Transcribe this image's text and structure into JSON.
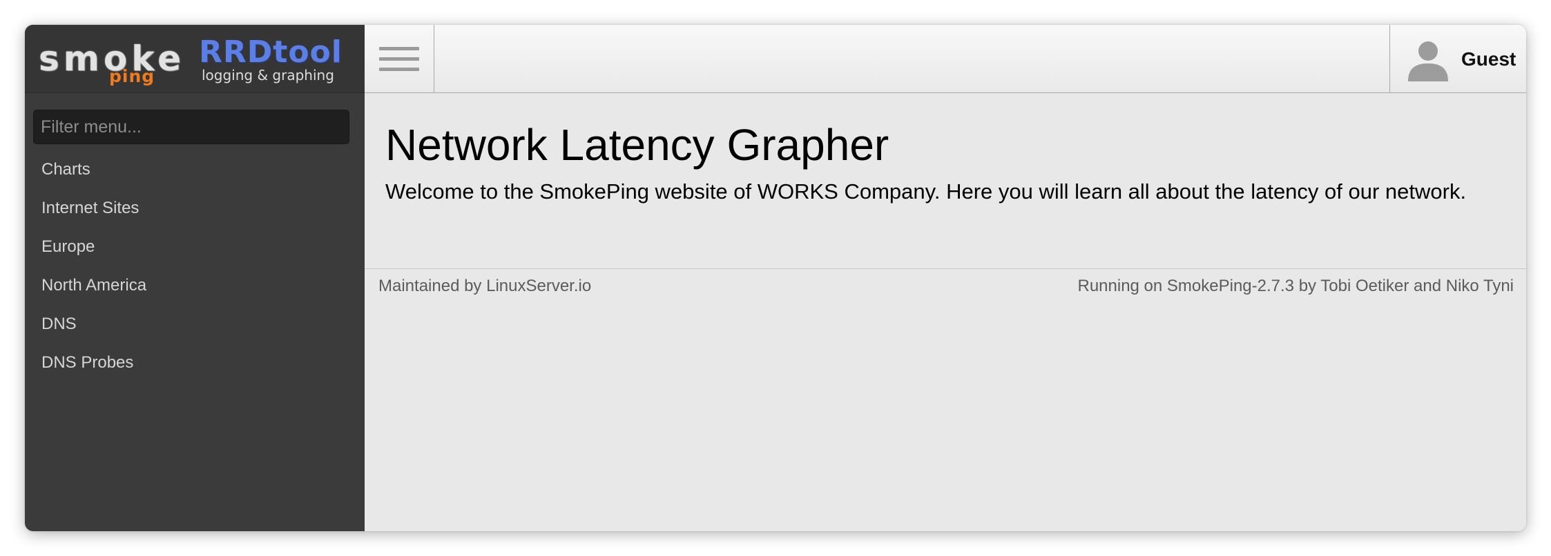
{
  "logos": {
    "smokeping_main": "smoke",
    "smokeping_sub": "ping",
    "rrdtool_main": "RRDtool",
    "rrdtool_sub": "logging & graphing"
  },
  "sidebar": {
    "filter_placeholder": "Filter menu...",
    "items": [
      {
        "label": "Charts"
      },
      {
        "label": "Internet Sites"
      },
      {
        "label": "Europe"
      },
      {
        "label": "North America"
      },
      {
        "label": "DNS"
      },
      {
        "label": "DNS Probes"
      }
    ]
  },
  "header": {
    "menu_icon": "hamburger-icon",
    "user_icon": "user-silhouette-icon",
    "user_name": "Guest"
  },
  "main": {
    "title": "Network Latency Grapher",
    "description": "Welcome to the SmokePing website of WORKS Company. Here you will learn all about the latency of our network."
  },
  "footer": {
    "maintained_prefix": "Maintained by ",
    "maintained_link": "LinuxServer.io",
    "running_prefix": "Running on ",
    "running_link": "SmokePing-2.7.3",
    "running_by": " by ",
    "author_1": "Tobi Oetiker",
    "author_and": " and ",
    "author_2": "Niko Tyni"
  },
  "colors": {
    "sidebar_bg": "#3b3b3b",
    "content_bg": "#e8e8e8",
    "rrdtool_blue": "#5b7fe6",
    "ping_orange": "#f07a1e"
  }
}
